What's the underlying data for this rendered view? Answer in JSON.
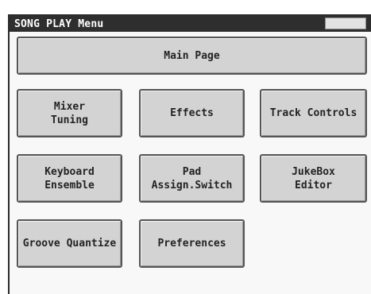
{
  "window": {
    "title": "SONG PLAY Menu"
  },
  "buttons": {
    "main_page": "Main Page",
    "mixer_tuning": "Mixer\nTuning",
    "effects": "Effects",
    "track_controls": "Track Controls",
    "keyboard_ensemble": "Keyboard\nEnsemble",
    "pad_assign_switch": "Pad\nAssign.Switch",
    "jukebox_editor": "JukeBox\nEditor",
    "groove_quantize": "Groove Quantize",
    "preferences": "Preferences"
  },
  "colors": {
    "titlebar": "#2e2e2e",
    "button_face": "#d3d3d3",
    "button_border": "#555555",
    "background": "#f8f8f8"
  }
}
